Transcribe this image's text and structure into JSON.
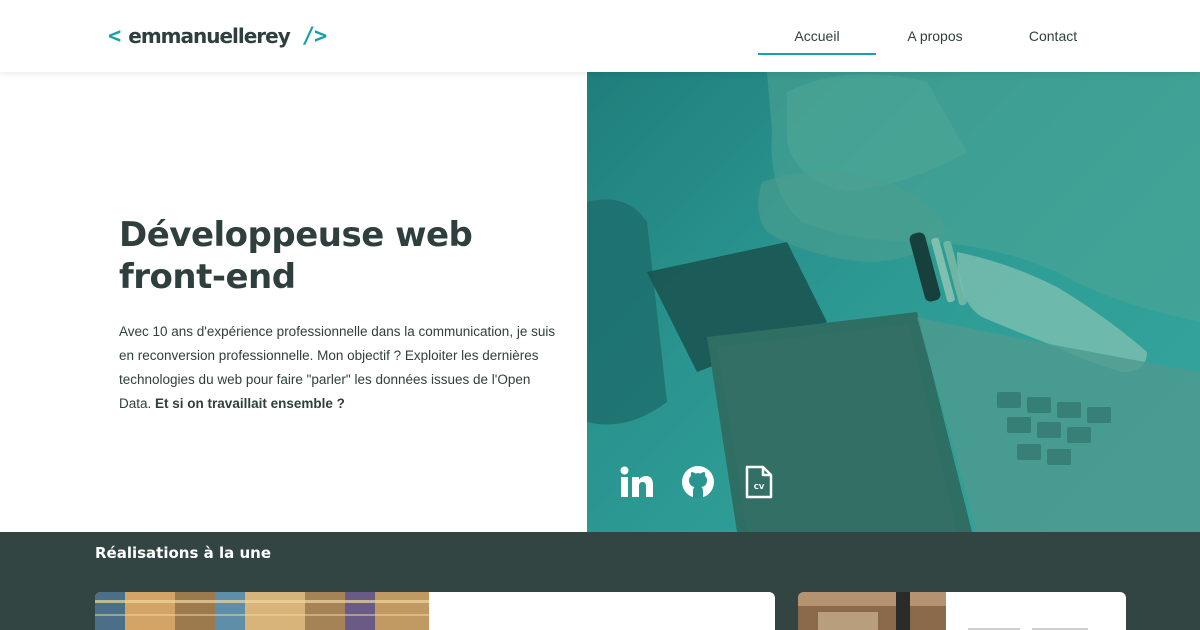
{
  "header": {
    "logo": {
      "open": "<",
      "name": "emmanuellerey",
      "close": "/>"
    },
    "nav": [
      {
        "label": "Accueil",
        "active": true
      },
      {
        "label": "A propos",
        "active": false
      },
      {
        "label": "Contact",
        "active": false
      }
    ]
  },
  "hero": {
    "title": "Développeuse web front-end",
    "text": "Avec 10 ans d'expérience professionnelle dans la communication, je suis en reconversion professionnelle. Mon objectif ? Exploiter les dernières technologies du web pour faire \"parler\" les données issues de l'Open Data.",
    "text_bold": "Et si on travaillait ensemble ?",
    "socials": [
      {
        "icon": "linkedin-icon"
      },
      {
        "icon": "github-icon"
      },
      {
        "icon": "cv-document-icon",
        "label": "CV"
      }
    ]
  },
  "projects": {
    "title": "Réalisations à la une"
  },
  "colors": {
    "accent": "#15a3a8",
    "text_dark": "#2f3f3d",
    "section_dark": "#334543",
    "hero_overlay": "#2a948f"
  }
}
